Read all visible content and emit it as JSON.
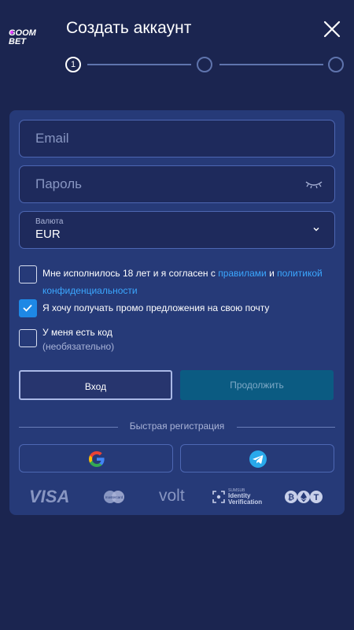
{
  "header": {
    "logo_text": "GOOM BET",
    "title": "Создать аккаунт",
    "close_label": "close",
    "steps": [
      "1",
      "",
      ""
    ]
  },
  "form": {
    "email_placeholder": "Email",
    "password_placeholder": "Пароль",
    "currency_label": "Валюта",
    "currency_value": "EUR",
    "age_text_1": "Мне исполнилось 18 лет и я согласен с ",
    "age_link_rules": "правилами",
    "age_text_2": " и ",
    "age_link_privacy": "политикой конфиденциальности",
    "age_checked": false,
    "promo_text": "Я хочу получать промо предложения на свою почту",
    "promo_checked": true,
    "code_text": "У меня есть код",
    "code_optional": "(необязательно)",
    "code_checked": false,
    "login_button": "Вход",
    "continue_button": "Продолжить",
    "quick_reg": "Быстрая регистрация"
  },
  "social": [
    "google-icon",
    "telegram-icon"
  ],
  "payments": {
    "visa": "VISA",
    "mastercard": "mastercard",
    "volt": "volt",
    "identity_small": "SUMSUB",
    "identity_line1": "Identity",
    "identity_line2": "Verification"
  },
  "colors": {
    "background": "#1b2550",
    "card": "#263a78",
    "accent": "#1e88e5",
    "link": "#3ba7ff",
    "continue_button": "#0b5b82"
  }
}
